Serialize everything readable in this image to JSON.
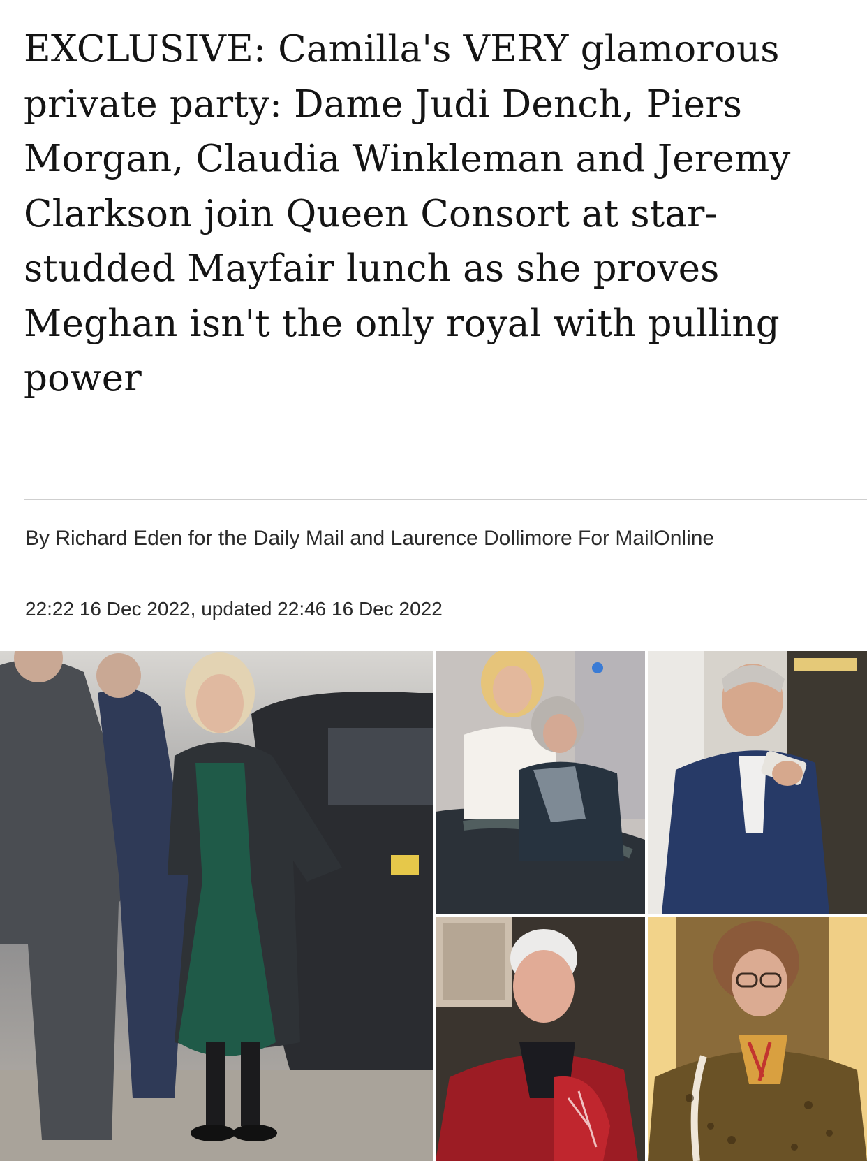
{
  "article": {
    "headline": "EXCLUSIVE: Camilla's VERY glamorous private party: Dame Judi Dench, Piers Morgan, Claudia Winkleman and Jeremy Clarkson join Queen Consort at star-studded Mayfair lunch as she proves Meghan isn't the only royal with pulling power",
    "byline": "By Richard Eden for the Daily Mail and Laurence Dollimore For MailOnline",
    "dateline": "22:22 16 Dec 2022, updated 22:46 16 Dec 2022"
  },
  "photos": [
    {
      "name": "camilla-photo"
    },
    {
      "name": "blonde-woman-and-grey-haired-woman-photo"
    },
    {
      "name": "man-in-blue-suit-with-phone-photo"
    },
    {
      "name": "white-haired-woman-in-red-coat-photo"
    },
    {
      "name": "woman-with-glasses-in-leopard-coat-photo"
    }
  ]
}
